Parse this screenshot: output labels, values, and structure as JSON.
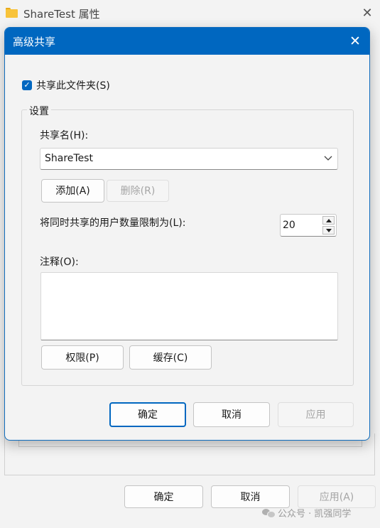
{
  "background_window": {
    "title": "ShareTest 属性",
    "buttons": {
      "ok": "确定",
      "cancel": "取消",
      "apply": "应用(A)"
    },
    "watermark": "公众号 · 凯强同学"
  },
  "dialog": {
    "title": "高级共享",
    "share_checkbox": {
      "label": "共享此文件夹(S)",
      "checked": true
    },
    "settings_group": {
      "label": "设置",
      "share_name_label": "共享名(H):",
      "share_name_value": "ShareTest",
      "add_button": "添加(A)",
      "remove_button": "删除(R)",
      "user_limit_label": "将同时共享的用户数量限制为(L):",
      "user_limit_value": "20",
      "comment_label": "注释(O):",
      "comment_value": "",
      "permissions_button": "权限(P)",
      "caching_button": "缓存(C)"
    },
    "buttons": {
      "ok": "确定",
      "cancel": "取消",
      "apply": "应用"
    }
  },
  "colors": {
    "accent": "#0067c0",
    "folder": "#f8c33a"
  }
}
